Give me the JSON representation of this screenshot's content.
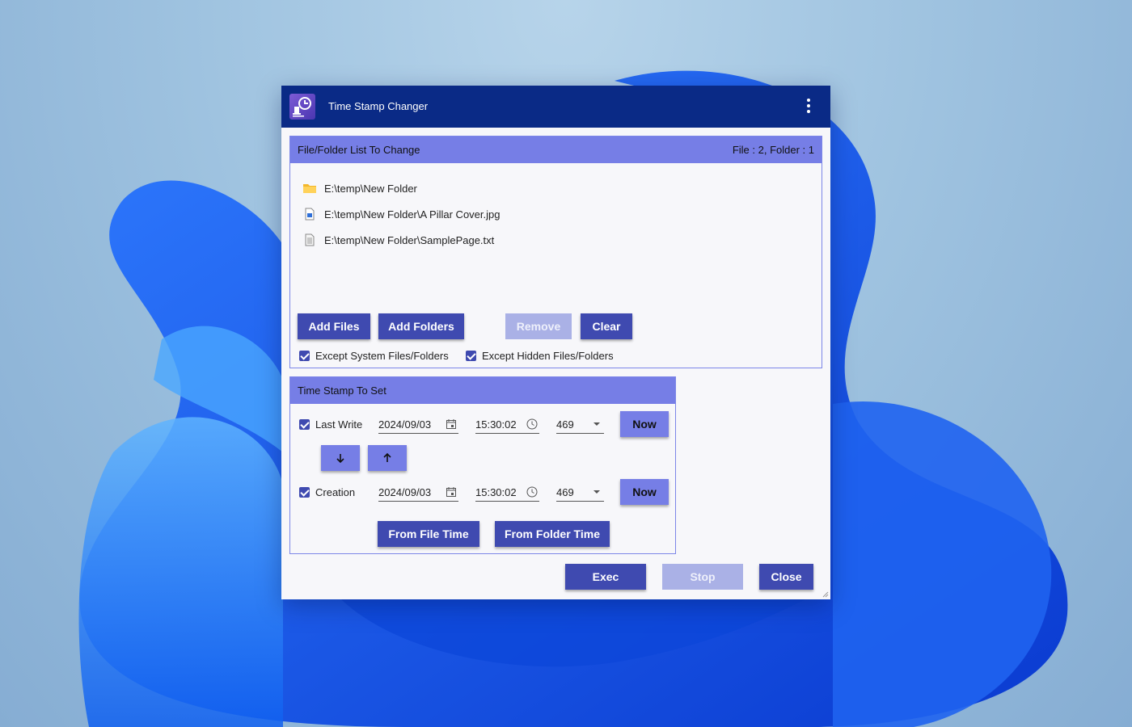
{
  "window": {
    "title": "Time Stamp Changer",
    "menu_icon": "kebab-menu-icon"
  },
  "file_section": {
    "header": "File/Folder List To Change",
    "count": "File : 2, Folder : 1",
    "items": [
      {
        "icon": "folder-icon",
        "path": "E:\\temp\\New Folder"
      },
      {
        "icon": "image-file-icon",
        "path": "E:\\temp\\New Folder\\A Pillar Cover.jpg"
      },
      {
        "icon": "text-file-icon",
        "path": "E:\\temp\\New Folder\\SamplePage.txt"
      }
    ],
    "buttons": {
      "add_files": "Add Files",
      "add_folders": "Add Folders",
      "remove": "Remove",
      "clear": "Clear"
    },
    "options": {
      "except_system": "Except System Files/Folders",
      "except_hidden": "Except Hidden Files/Folders"
    }
  },
  "timestamp_section": {
    "header": "Time Stamp To Set",
    "last_write": {
      "label": "Last Write",
      "date": "2024/09/03",
      "time": "15:30:02",
      "ms": "469",
      "now": "Now"
    },
    "creation": {
      "label": "Creation",
      "date": "2024/09/03",
      "time": "15:30:02",
      "ms": "469",
      "now": "Now"
    },
    "from_file_time": "From File Time",
    "from_folder_time": "From Folder Time"
  },
  "footer": {
    "exec": "Exec",
    "stop": "Stop",
    "close": "Close"
  },
  "colors": {
    "titlebar": "#0a2a86",
    "section_header": "#767ee6",
    "primary_button": "#3f4ab0",
    "disabled_button": "#aab1e6"
  }
}
